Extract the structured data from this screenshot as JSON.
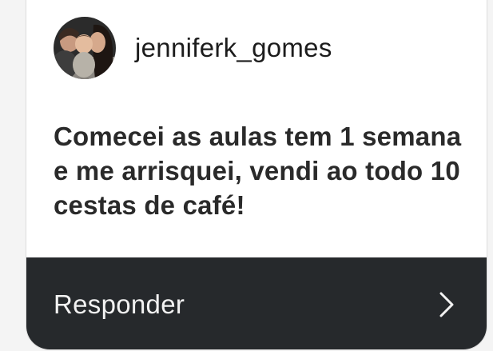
{
  "post": {
    "username": "jenniferk_gomes",
    "avatar": "profile-photo",
    "message": "Comecei as aulas tem 1 semana e me arrisquei, vendi ao todo 10 cestas de café!"
  },
  "reply": {
    "label": "Responder",
    "icon": "chevron-right-icon"
  },
  "colors": {
    "card_bg": "#ffffff",
    "reply_bar_bg": "#26292c",
    "reply_text": "#f2f2f2",
    "message_text": "#2a2a2a"
  }
}
